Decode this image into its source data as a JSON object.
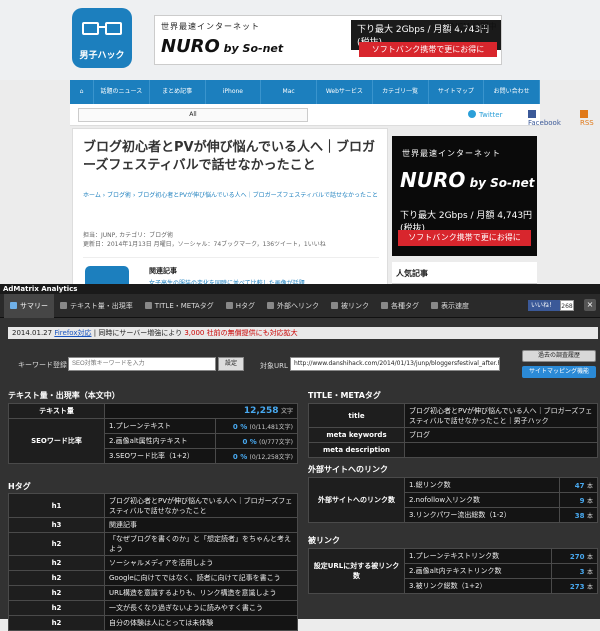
{
  "site": {
    "logo_text": "男子ハック",
    "ad_banner": {
      "line1": "世界最速インターネット",
      "brand": "NURO",
      "brand_by": " by So-net",
      "speed": "下り最大 2Gbps / 月額 4,743円(税抜)",
      "tvcm": "TVCM 公開中",
      "softbank": "ソフトバンク携帯で更にお得に"
    },
    "nav": [
      "話題のニュース",
      "まとめ記事",
      "iPhone",
      "Mac",
      "Webサービス",
      "カテゴリ一覧",
      "サイトマップ",
      "お問い合わせ"
    ],
    "search_value": "All",
    "twitter": "Twitter",
    "facebook": "Facebook",
    "rss": "RSS",
    "article": {
      "title": "ブログ初心者とPVが伸び悩んでいる人へ｜ブロガーズフェスティバルで話せなかったこと",
      "breadcrumb": "ホーム › ブログ術 › ブログ初心者とPVが伸び悩んでいる人へ｜ブロガーズフェスティバルで話せなかったこと",
      "meta1": "担当：JUNP, カテゴリ：ブログ術",
      "meta2": "更新日：2014年1月13日 月曜日，ソーシャル：74ブックマーク，136ツイート，1いいね",
      "related_heading": "関連記事",
      "related_link": "女子高生の服装の変化を同時に並べて比較した画像が話題"
    },
    "side_ad": {
      "line1": "世界最速インターネット",
      "brand": "NURO",
      "brand_by": " by So-net",
      "speed": "下り最大 2Gbps / 月額 4,743円(税抜)",
      "softbank": "ソフトバンク携帯で更にお得に"
    },
    "side_heading": "人気記事"
  },
  "admatrix": {
    "title": "AdMatrix Analytics",
    "tabs": [
      "サマリー",
      "テキスト量・出現率",
      "TITLE・METAタグ",
      "Hタグ",
      "外部へリンク",
      "被リンク",
      "各種タグ",
      "表示速度"
    ],
    "active_tab": 0,
    "fb_like": "いいね！",
    "fb_count": "268",
    "close": "×",
    "notice_date": "2014.01.27",
    "notice_link": "Firefox対応",
    "notice_text": "| 同時にサーバー増強により",
    "notice_red": "3,000 社前の無償提供にも対応拡大",
    "keyword_label": "キーワード登録",
    "keyword_placeholder": "SEO対策キーワードを入力",
    "keyword_button": "設定",
    "url_label": "対象URL",
    "url_value": "http://www.danshihack.com/2014/01/13/junp/bloggersfestival_after.html",
    "btn_past": "過去の調査履歴",
    "btn_sitemap": "サイトマッピング機能",
    "text_section": {
      "heading": "テキスト量・出現率（本文中）",
      "text_volume_label": "テキスト量",
      "text_volume": "12,258",
      "text_unit": "文字",
      "seo_label": "SEOワード比率",
      "rows": [
        {
          "label": "1.プレーンテキスト",
          "pct": "0",
          "detail": "(0/11,481文字)"
        },
        {
          "label": "2.画像alt属性内テキスト",
          "pct": "0",
          "detail": "(0/777文字)"
        },
        {
          "label": "3.SEOワード比率（1+2）",
          "pct": "0",
          "detail": "(0/12,258文字)"
        }
      ]
    },
    "title_section": {
      "heading": "TITLE・METAタグ",
      "rows": [
        {
          "label": "title",
          "value": "ブログ初心者とPVが伸び悩んでいる人へ｜ブロガーズフェスティバルで話せなかったこと｜男子ハック"
        },
        {
          "label": "meta keywords",
          "value": "ブログ"
        },
        {
          "label": "meta description",
          "value": ""
        }
      ]
    },
    "ext_section": {
      "heading": "外部サイトへのリンク",
      "label": "外部サイトへのリンク数",
      "rows": [
        {
          "label": "1.総リンク数",
          "value": "47",
          "unit": "本"
        },
        {
          "label": "2.nofollow入リンク数",
          "value": "9",
          "unit": "本"
        },
        {
          "label": "3.リンクパワー流出総数（1-2）",
          "value": "38",
          "unit": "本"
        }
      ]
    },
    "backlink_section": {
      "heading": "被リンク",
      "label": "設定URLに対する被リンク数",
      "rows": [
        {
          "label": "1.プレーンテキストリンク数",
          "value": "270",
          "unit": "本"
        },
        {
          "label": "2.画像alt内テキストリンク数",
          "value": "3",
          "unit": "本"
        },
        {
          "label": "3.被リンク総数（1+2）",
          "value": "273",
          "unit": "本"
        }
      ]
    },
    "h_section": {
      "heading": "Hタグ",
      "rows": [
        {
          "tag": "h1",
          "text": "ブログ初心者とPVが伸び悩んでいる人へ｜ブロガーズフェスティバルで話せなかったこと"
        },
        {
          "tag": "h3",
          "text": "関連記事"
        },
        {
          "tag": "h2",
          "text": "「なぜブログを書くのか」と「想定読者」をちゃんと考えよう"
        },
        {
          "tag": "h2",
          "text": "ソーシャルメディアを活用しよう"
        },
        {
          "tag": "h2",
          "text": "Googleに向けてではなく、読者に向けて記事を書こう"
        },
        {
          "tag": "h2",
          "text": "URL構造を意識するよりも、リンク構造を意識しよう"
        },
        {
          "tag": "h2",
          "text": "一文が長くなり過ぎないように読みやすく書こう"
        },
        {
          "tag": "h2",
          "text": "自分の体験は人にとっては未体験"
        }
      ]
    }
  }
}
